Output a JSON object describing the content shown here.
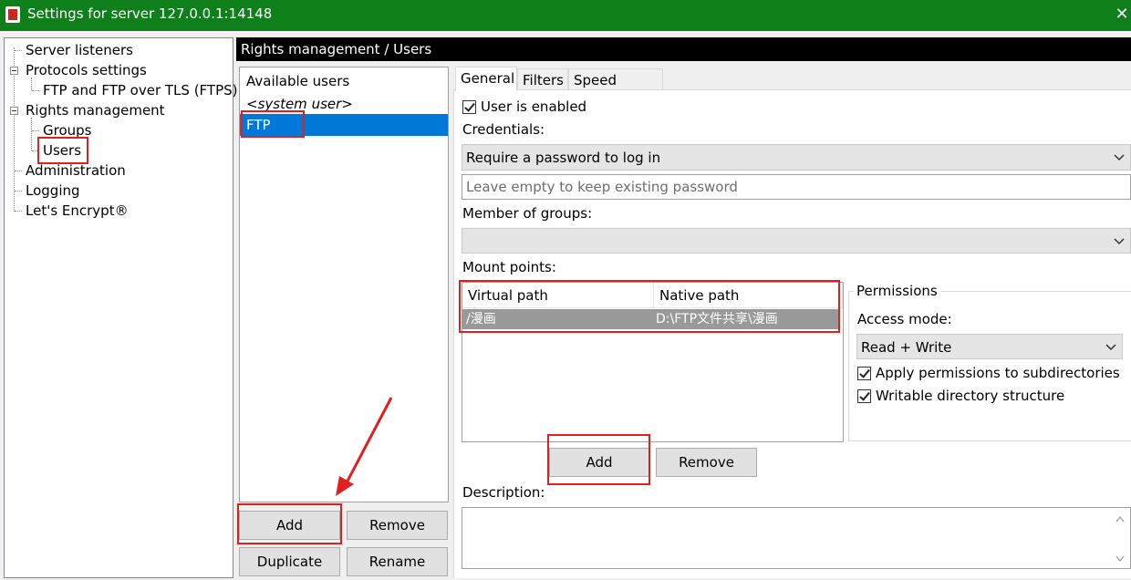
{
  "window": {
    "title": "Settings for server 127.0.0.1:14148",
    "close_glyph": "✕"
  },
  "tree": {
    "items": [
      "Server listeners",
      "Protocols settings",
      "FTP and FTP over TLS (FTPS)",
      "Rights management",
      "Groups",
      "Users",
      "Administration",
      "Logging",
      "Let's Encrypt®"
    ]
  },
  "header": {
    "title": "Rights management / Users"
  },
  "users": {
    "header": "Available users",
    "items": [
      "<system user>",
      "FTP"
    ],
    "selected": "FTP",
    "add_label": "Add",
    "remove_label": "Remove",
    "duplicate_label": "Duplicate",
    "rename_label": "Rename"
  },
  "tabs": [
    "General",
    "Filters",
    "Speed Limits"
  ],
  "general": {
    "enabled_label": "User is enabled",
    "enabled_checked": true,
    "credentials_label": "Credentials:",
    "credentials_value": "Require a password to log in",
    "password_placeholder": "Leave empty to keep existing password",
    "groups_label": "Member of groups:",
    "groups_value": "",
    "mount_label": "Mount points:",
    "mount_columns": [
      "Virtual path",
      "Native path"
    ],
    "mount_rows": [
      {
        "virtual": "/漫画",
        "native": "D:\\FTP文件共享\\漫画"
      }
    ],
    "mount_add_label": "Add",
    "mount_remove_label": "Remove",
    "description_label": "Description:"
  },
  "permissions": {
    "title": "Permissions",
    "access_label": "Access mode:",
    "access_value": "Read + Write",
    "apply_sub_label": "Apply permissions to subdirectories",
    "apply_sub_checked": true,
    "writable_label": "Writable directory structure",
    "writable_checked": true
  },
  "colors": {
    "titlebar": "#0e7f1a",
    "selection": "#0078d7",
    "annotation": "#e02020"
  }
}
